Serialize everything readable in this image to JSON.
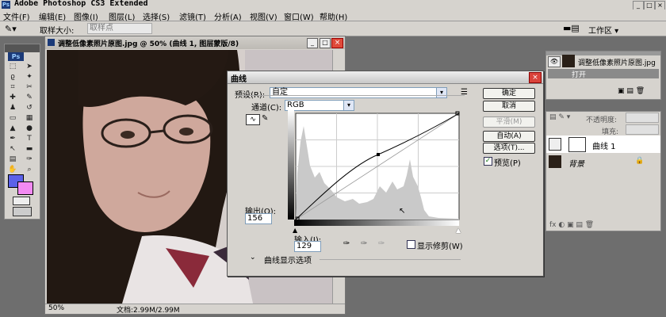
{
  "app": {
    "title": "Adobe Photoshop CS3 Extended"
  },
  "menu": [
    "文件(F)",
    "编辑(E)",
    "图像(I)",
    "图层(L)",
    "选择(S)",
    "滤镜(T)",
    "分析(A)",
    "视图(V)",
    "窗口(W)",
    "帮助(H)"
  ],
  "options_bar": {
    "sample_label": "取样大小:",
    "sample_value": "取样点",
    "workspace": "工作区 ▾"
  },
  "toolbox": {
    "logo": "Ps"
  },
  "image_window": {
    "title": "调整低像素照片原图.jpg @ 50% (曲线 1, 图层蒙版/8)",
    "zoom": "50%",
    "doc_info": "文档:2.99M/2.99M"
  },
  "curves": {
    "title": "曲线",
    "preset_label": "预设(R):",
    "preset_value": "自定",
    "channel_label": "通道(C):",
    "channel_value": "RGB",
    "output_label": "输出(O):",
    "output_value": "156",
    "input_label": "输入(I):",
    "input_value": "129",
    "show_clipping": "显示修剪(W)",
    "display_options": "曲线显示选项",
    "buttons": {
      "ok": "确定",
      "cancel": "取消",
      "smooth": "平滑(M)",
      "auto": "自动(A)",
      "options": "选项(T)...",
      "preview": "预览(P)"
    },
    "preview_checked": true,
    "curve_point": {
      "input": 129,
      "output": 156
    }
  },
  "history_panel": {
    "snapshot": "调整低像素照片原图.jpg",
    "step": "打开"
  },
  "layers_panel": {
    "opacity_label": "不透明度:",
    "fill_label": "填充:",
    "layers": [
      "曲线 1",
      "背景"
    ]
  }
}
